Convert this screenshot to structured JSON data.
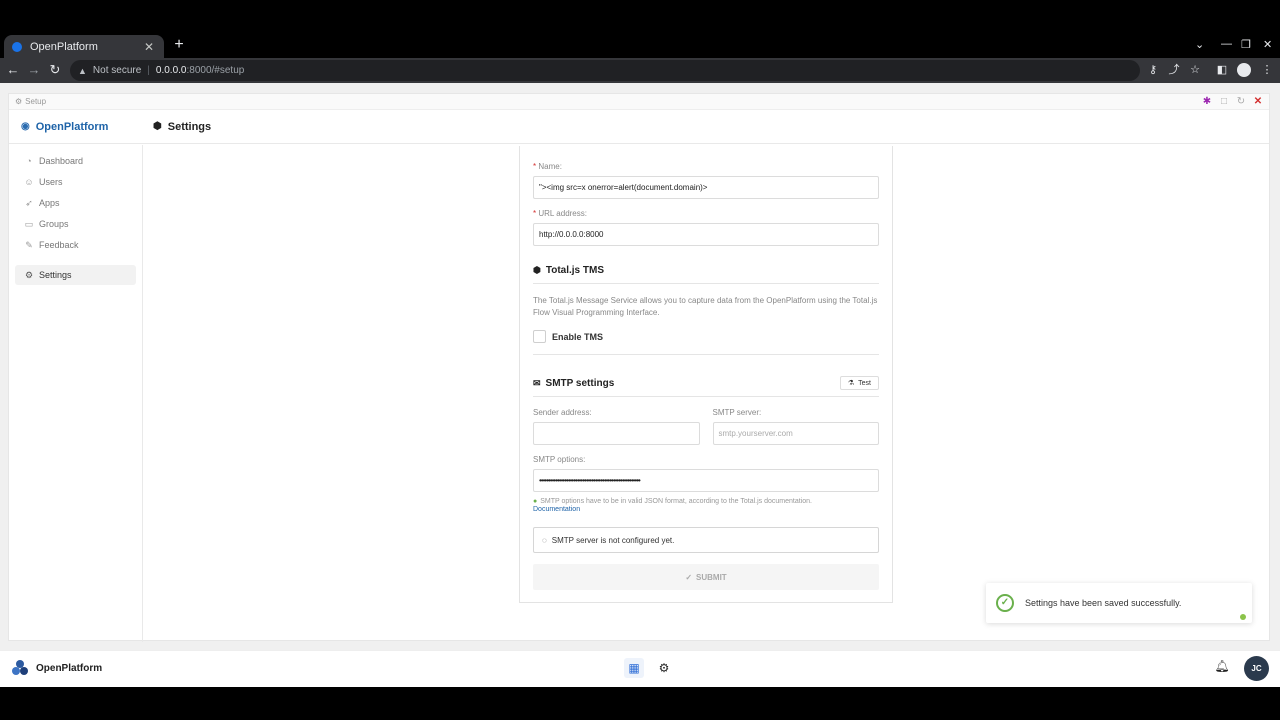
{
  "browser": {
    "tab_title": "OpenPlatform",
    "tab_close": "✕",
    "new_tab": "+",
    "not_secure": "Not secure",
    "url_host": "0.0.0.0",
    "url_rest": ":8000/#setup"
  },
  "window": {
    "title": "Setup"
  },
  "header": {
    "brand": "OpenPlatform",
    "page_title": "Settings"
  },
  "sidebar": {
    "items": [
      {
        "label": "Dashboard"
      },
      {
        "label": "Users"
      },
      {
        "label": "Apps"
      },
      {
        "label": "Groups"
      },
      {
        "label": "Feedback"
      },
      {
        "label": "Settings"
      }
    ]
  },
  "form": {
    "name_label": "Name:",
    "name_value": "\"><img src=x onerror=alert(document.domain)>",
    "url_label": "URL address:",
    "url_value": "http://0.0.0.0:8000",
    "tms_title": "Total.js TMS",
    "tms_desc": "The Total.js Message Service allows you to capture data from the OpenPlatform using the Total.js Flow Visual Programming Interface.",
    "tms_checkbox": "Enable TMS",
    "smtp_title": "SMTP settings",
    "test_button": "Test",
    "sender_label": "Sender address:",
    "sender_value": "",
    "smtp_server_label": "SMTP server:",
    "smtp_server_placeholder": "smtp.yourserver.com",
    "smtp_options_label": "SMTP options:",
    "smtp_options_value": "••••••••••••••••••••••••••••••••••••••••••••••••••••••••",
    "smtp_help": "SMTP options have to be in valid JSON format, according to the Total.js documentation.",
    "documentation_link": "Documentation",
    "smtp_notice": "SMTP server is not configured yet.",
    "submit": "SUBMIT"
  },
  "toast": {
    "message": "Settings have been saved successfully."
  },
  "dock": {
    "brand": "OpenPlatform",
    "avatar_initials": "JC"
  },
  "colors": {
    "brand": "#1e63a8",
    "success": "#6ab04c",
    "required": "#d32f2f",
    "avatar_bg": "#2b3a4d"
  }
}
